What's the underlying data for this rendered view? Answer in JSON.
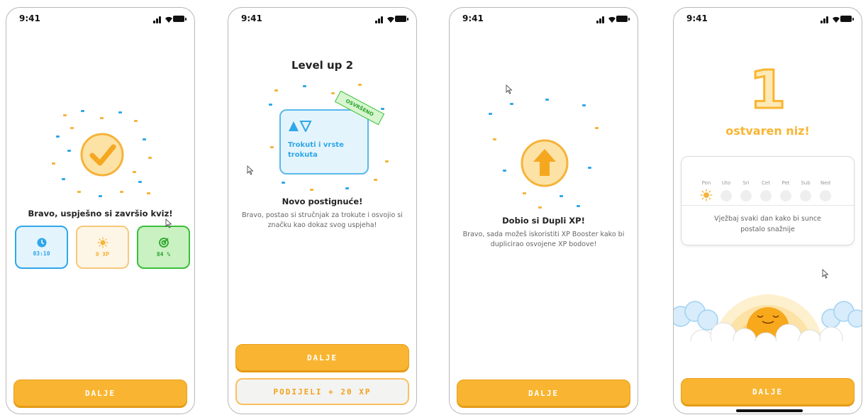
{
  "status_time": "9:41",
  "screen1": {
    "title": "Bravo, uspješno si završio kviz!",
    "stats": [
      {
        "value": "03:10",
        "color": "#2fa7e8",
        "icon": "clock-icon"
      },
      {
        "value": "0 XP",
        "color": "#f5b33a",
        "icon": "sun-icon"
      },
      {
        "value": "84 %",
        "color": "#3bbf3b",
        "icon": "target-icon"
      }
    ],
    "button": "DALJE"
  },
  "screen2": {
    "heading": "Level up 2",
    "badge_label": "Trokuti i vrste trokuta",
    "stamp": "OSVRŠENO",
    "title": "Novo postignuće!",
    "subtitle": "Bravo, postao si stručnjak za trokute i osvojio si značku kao dokaz svog uspjeha!",
    "button_primary": "DALJE",
    "button_secondary": "PODIJELI + 20 XP"
  },
  "screen3": {
    "title": "Dobio si Dupli XP!",
    "subtitle": "Bravo, sada možeš iskoristiti XP Booster kako bi duplicirao osvojene XP bodove!",
    "button": "DALJE"
  },
  "screen4": {
    "streak_number": "1",
    "streak_label": "ostvaren niz!",
    "days": [
      "Pon",
      "Uto",
      "Sri",
      "Cet",
      "Pet",
      "Sub",
      "Ned"
    ],
    "message": "Vježbaj svaki dan kako bi sunce postalo snažnije",
    "button": "DALJE"
  },
  "colors": {
    "accent": "#f9b531",
    "blue": "#2fa7e8",
    "green": "#3bbf3b"
  }
}
